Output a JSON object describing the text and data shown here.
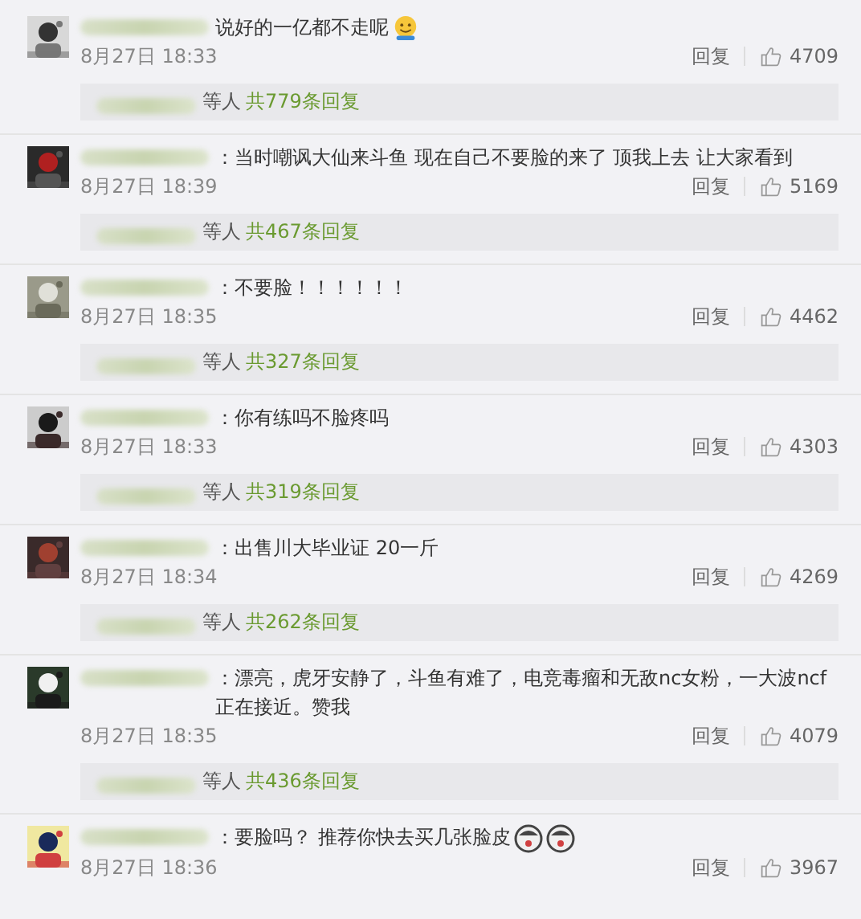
{
  "comments": [
    {
      "text": "说好的一亿都不走呢",
      "emojis": [
        {
          "kind": "smile"
        }
      ],
      "date": "8月27日 18:33",
      "reply_label": "回复",
      "likes": "4709",
      "thread": {
        "suffix": "等人",
        "count": "共779条回复"
      }
    },
    {
      "text": "：当时嘲讽大仙来斗鱼 现在自己不要脸的来了 顶我上去 让大家看到",
      "date": "8月27日 18:39",
      "reply_label": "回复",
      "likes": "5169",
      "thread": {
        "suffix": "等人",
        "count": "共467条回复"
      }
    },
    {
      "text": "：不要脸！！！！！！",
      "date": "8月27日 18:35",
      "reply_label": "回复",
      "likes": "4462",
      "thread": {
        "suffix": "等人",
        "count": "共327条回复"
      }
    },
    {
      "text": "：你有练吗不脸疼吗",
      "date": "8月27日 18:33",
      "reply_label": "回复",
      "likes": "4303",
      "thread": {
        "suffix": "等人",
        "count": "共319条回复"
      }
    },
    {
      "text": "：出售川大毕业证  20一斤",
      "date": "8月27日 18:34",
      "reply_label": "回复",
      "likes": "4269",
      "thread": {
        "suffix": "等人",
        "count": "共262条回复"
      }
    },
    {
      "text": "：漂亮，虎牙安静了，斗鱼有难了，电竞毒瘤和无敌nc女粉，一大波ncf正在接近。赞我",
      "date": "8月27日 18:35",
      "reply_label": "回复",
      "likes": "4079",
      "thread": {
        "suffix": "等人",
        "count": "共436条回复"
      }
    },
    {
      "text": "：要脸吗？ 推荐你快去买几张脸皮",
      "emojis": [
        {
          "kind": "face"
        },
        {
          "kind": "face"
        }
      ],
      "date": "8月27日 18:36",
      "reply_label": "回复",
      "likes": "3967"
    }
  ]
}
